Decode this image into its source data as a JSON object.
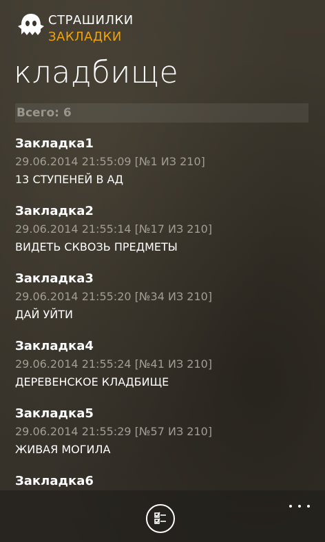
{
  "header": {
    "app_title": "СТРАШИЛКИ",
    "section": "ЗАКЛАДКИ"
  },
  "page_title": "кладбище",
  "total_label": "Всего: 6",
  "bookmarks": [
    {
      "title": "Закладка1",
      "meta": "29.06.2014 21:55:09 [№1 ИЗ 210]",
      "name": "13 СТУПЕНЕЙ В АД"
    },
    {
      "title": "Закладка2",
      "meta": "29.06.2014 21:55:14 [№17 ИЗ 210]",
      "name": "ВИДЕТЬ СКВОЗЬ ПРЕДМЕТЫ"
    },
    {
      "title": "Закладка3",
      "meta": "29.06.2014 21:55:20 [№34 ИЗ 210]",
      "name": "ДАЙ УЙТИ"
    },
    {
      "title": "Закладка4",
      "meta": "29.06.2014 21:55:24 [№41 ИЗ 210]",
      "name": "ДЕРЕВЕНСКОЕ КЛАДБИЩЕ"
    },
    {
      "title": "Закладка5",
      "meta": "29.06.2014 21:55:29 [№57 ИЗ 210]",
      "name": "ЖИВАЯ МОГИЛА"
    },
    {
      "title": "Закладка6",
      "meta": "",
      "name": ""
    }
  ],
  "colors": {
    "accent": "#f0a30a",
    "meta_text": "#a29e95",
    "background": "#3a352c"
  },
  "icons": {
    "logo": "ghost-icon",
    "appbar_select": "checklist-icon",
    "more": "more-dots-icon"
  }
}
